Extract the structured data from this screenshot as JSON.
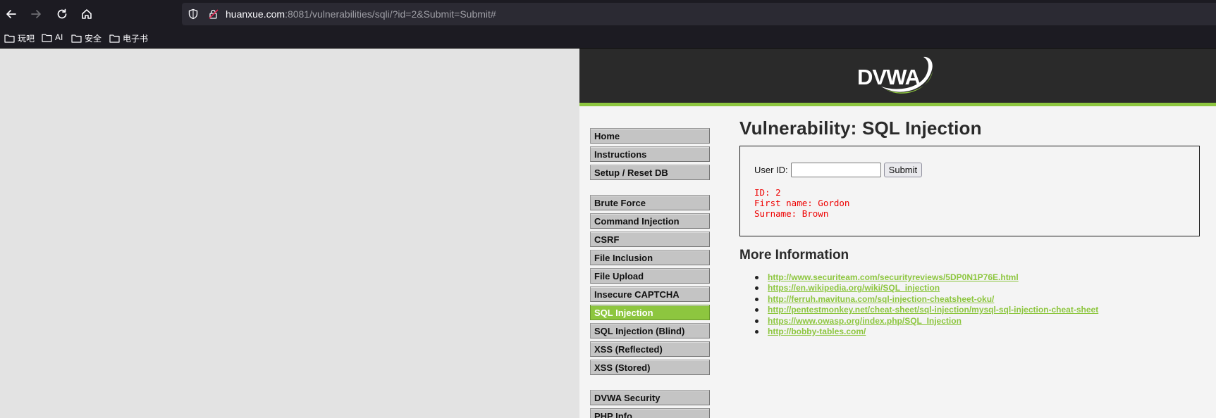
{
  "browser": {
    "url_host": "huanxue.com",
    "url_rest": ":8081/vulnerabilities/sqli/?id=2&Submit=Submit#",
    "bookmarks": [
      "玩吧",
      "AI",
      "安全",
      "电子书"
    ]
  },
  "header": {
    "logo_text": "DVWA",
    "accent_color": "#8dc63f"
  },
  "menu": {
    "group1": [
      "Home",
      "Instructions",
      "Setup / Reset DB"
    ],
    "group2": [
      "Brute Force",
      "Command Injection",
      "CSRF",
      "File Inclusion",
      "File Upload",
      "Insecure CAPTCHA",
      "SQL Injection",
      "SQL Injection (Blind)",
      "XSS (Reflected)",
      "XSS (Stored)"
    ],
    "group3": [
      "DVWA Security",
      "PHP Info"
    ],
    "active": "SQL Injection"
  },
  "main": {
    "title": "Vulnerability: SQL Injection",
    "user_id_label": "User ID:",
    "user_id_value": "",
    "submit_label": "Submit",
    "result_lines": [
      "ID: 2",
      "First name: Gordon",
      "Surname: Brown"
    ],
    "result_color": "#ee0000",
    "more_info_title": "More Information",
    "links": [
      "http://www.securiteam.com/securityreviews/5DP0N1P76E.html",
      "https://en.wikipedia.org/wiki/SQL_injection",
      "http://ferruh.mavituna.com/sql-injection-cheatsheet-oku/",
      "http://pentestmonkey.net/cheat-sheet/sql-injection/mysql-sql-injection-cheat-sheet",
      "https://www.owasp.org/index.php/SQL_Injection",
      "http://bobby-tables.com/"
    ]
  }
}
